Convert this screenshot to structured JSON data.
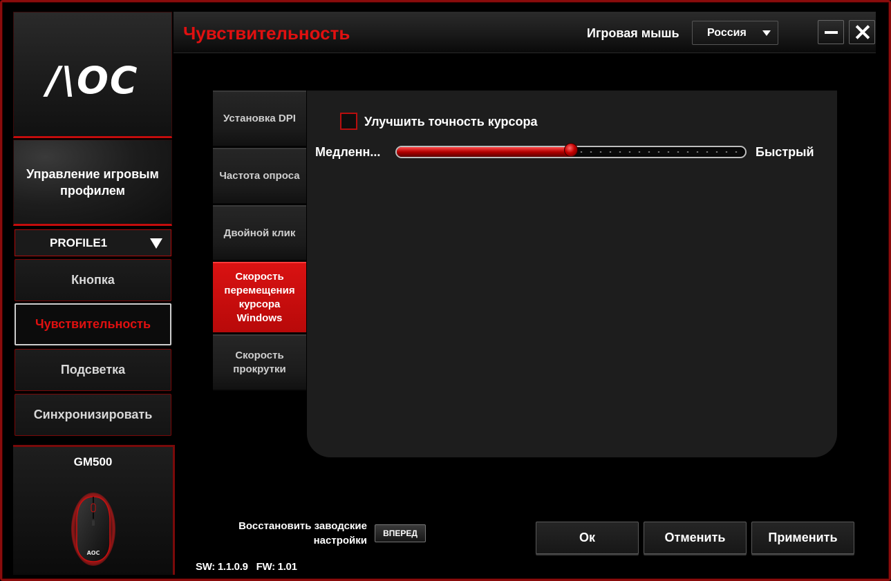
{
  "app": {
    "logo_text": "/\\OC",
    "accent_color": "#e01010"
  },
  "header": {
    "title": "Чувствительность",
    "device_label": "Игровая мышь",
    "language": "Россия"
  },
  "sidebar": {
    "profile_management": "Управление игровым профилем",
    "profile_selected": "PROFILE1",
    "nav": {
      "button": "Кнопка",
      "sensitivity": "Чувствительность",
      "lighting": "Подсветка",
      "sync": "Синхронизировать"
    },
    "device_name": "GM500",
    "mouse_logo": "AOC"
  },
  "subtabs": {
    "dpi": "Установка DPI",
    "polling": "Частота опроса",
    "double_click": "Двойной клик",
    "pointer_speed": "Скорость перемещения курсора Windows",
    "scroll_speed": "Скорость прокрутки"
  },
  "content": {
    "enhance_precision_label": "Улучшить точность курсора",
    "enhance_precision_checked": false,
    "slider_min_label": "Медленн...",
    "slider_max_label": "Быстрый",
    "slider_value_fraction": 0.5
  },
  "footer": {
    "restore_label": "Восстановить заводские настройки",
    "forward_button": "ВПЕРЕД",
    "sw_version": "SW: 1.1.0.9",
    "fw_version": "FW: 1.01",
    "ok": "Ок",
    "cancel": "Отменить",
    "apply": "Применить"
  }
}
